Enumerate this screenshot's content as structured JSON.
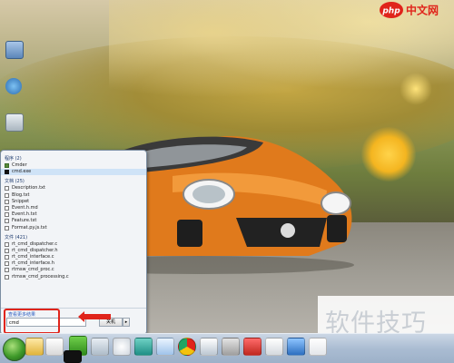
{
  "brand": {
    "logo_text": "php",
    "logo_sub": "中文网",
    "watermark": "软件技巧"
  },
  "start_menu": {
    "programs_header": "程序 (2)",
    "programs": [
      "Cmder",
      "cmd.exe"
    ],
    "documents_header": "文档 (25)",
    "documents": [
      "Description.txt",
      "Blog.txt",
      "Snippet",
      "Event.h.md",
      "Event.h.txt",
      "Feature.txt",
      "Format.py.js.txt"
    ],
    "files_header": "文件 (421)",
    "files": [
      "rt_cmd_dispatcher.c",
      "rt_cmd_dispatcher.h",
      "rt_cmd_interface.c",
      "rt_cmd_interface.h",
      "rtmsw_cmd_proc.c",
      "rtmsw_cmd_processing.c"
    ],
    "see_more": "查看更多结果",
    "search_value": "cmd",
    "shutdown_label": "关机"
  },
  "colors": {
    "highlight": "#e0241b",
    "taskbar": "#aabcd2"
  },
  "taskbar": {
    "items": [
      "folder-icon",
      "media-player-icon",
      "app-green-icon",
      "app-settings-icon",
      "clock-icon",
      "network-icon",
      "chrome-icon",
      "user-app-icon",
      "tool-icon",
      "app-red-icon",
      "calendar-icon",
      "app-blue-icon",
      "folder2-icon",
      "notepad-icon"
    ]
  }
}
